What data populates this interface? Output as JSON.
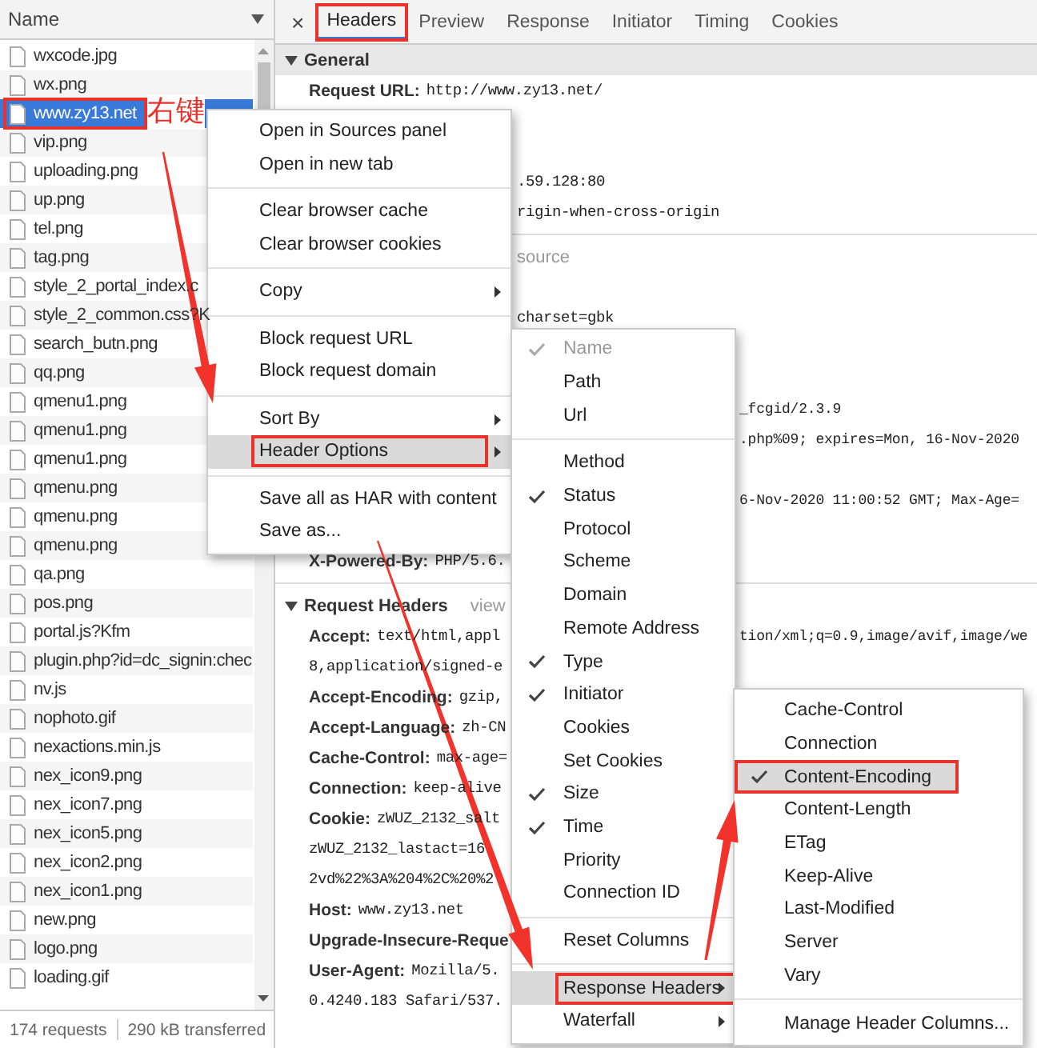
{
  "file_list": {
    "header": "Name",
    "files": [
      {
        "name": "wxcode.jpg",
        "selected": false,
        "boxed": false
      },
      {
        "name": "wx.png",
        "selected": false,
        "boxed": false
      },
      {
        "name": "www.zy13.net",
        "selected": true,
        "boxed": true
      },
      {
        "name": "vip.png",
        "selected": false,
        "boxed": false
      },
      {
        "name": "uploading.png",
        "selected": false,
        "boxed": false
      },
      {
        "name": "up.png",
        "selected": false,
        "boxed": false
      },
      {
        "name": "tel.png",
        "selected": false,
        "boxed": false
      },
      {
        "name": "tag.png",
        "selected": false,
        "boxed": false
      },
      {
        "name": "style_2_portal_index.c",
        "selected": false,
        "boxed": false
      },
      {
        "name": "style_2_common.css?K",
        "selected": false,
        "boxed": false
      },
      {
        "name": "search_butn.png",
        "selected": false,
        "boxed": false
      },
      {
        "name": "qq.png",
        "selected": false,
        "boxed": false
      },
      {
        "name": "qmenu1.png",
        "selected": false,
        "boxed": false
      },
      {
        "name": "qmenu1.png",
        "selected": false,
        "boxed": false
      },
      {
        "name": "qmenu1.png",
        "selected": false,
        "boxed": false
      },
      {
        "name": "qmenu.png",
        "selected": false,
        "boxed": false
      },
      {
        "name": "qmenu.png",
        "selected": false,
        "boxed": false
      },
      {
        "name": "qmenu.png",
        "selected": false,
        "boxed": false
      },
      {
        "name": "qa.png",
        "selected": false,
        "boxed": false
      },
      {
        "name": "pos.png",
        "selected": false,
        "boxed": false
      },
      {
        "name": "portal.js?Kfm",
        "selected": false,
        "boxed": false
      },
      {
        "name": "plugin.php?id=dc_signin:chec",
        "selected": false,
        "boxed": false
      },
      {
        "name": "nv.js",
        "selected": false,
        "boxed": false
      },
      {
        "name": "nophoto.gif",
        "selected": false,
        "boxed": false
      },
      {
        "name": "nexactions.min.js",
        "selected": false,
        "boxed": false
      },
      {
        "name": "nex_icon9.png",
        "selected": false,
        "boxed": false
      },
      {
        "name": "nex_icon7.png",
        "selected": false,
        "boxed": false
      },
      {
        "name": "nex_icon5.png",
        "selected": false,
        "boxed": false
      },
      {
        "name": "nex_icon2.png",
        "selected": false,
        "boxed": false
      },
      {
        "name": "nex_icon1.png",
        "selected": false,
        "boxed": false
      },
      {
        "name": "new.png",
        "selected": false,
        "boxed": false
      },
      {
        "name": "logo.png",
        "selected": false,
        "boxed": false
      },
      {
        "name": "loading.gif",
        "selected": false,
        "boxed": false
      }
    ],
    "status": {
      "requests": "174 requests",
      "transferred": "290 kB transferred"
    }
  },
  "annotation": "右键",
  "tabs": [
    {
      "label": "Headers",
      "selected": true,
      "boxed": true
    },
    {
      "label": "Preview",
      "selected": false,
      "boxed": false
    },
    {
      "label": "Response",
      "selected": false,
      "boxed": false
    },
    {
      "label": "Initiator",
      "selected": false,
      "boxed": false
    },
    {
      "label": "Timing",
      "selected": false,
      "boxed": false
    },
    {
      "label": "Cookies",
      "selected": false,
      "boxed": false
    }
  ],
  "close_glyph": "×",
  "lines": [
    {
      "kind": "section",
      "title": "General",
      "shaded": true
    },
    {
      "kind": "row",
      "key": "Request URL:",
      "value": "http://www.zy13.net/"
    },
    {
      "kind": "blank"
    },
    {
      "kind": "blank"
    },
    {
      "kind": "mid",
      "text": ".59.128:80"
    },
    {
      "kind": "mid",
      "text": "rigin-when-cross-origin"
    },
    {
      "kind": "rule"
    },
    {
      "kind": "mid-link",
      "text": "source"
    },
    {
      "kind": "blank"
    },
    {
      "kind": "mid",
      "text": "charset=gbk"
    },
    {
      "kind": "blank"
    },
    {
      "kind": "blank"
    },
    {
      "kind": "far",
      "text": "_fcgid/2.3.9"
    },
    {
      "kind": "far",
      "text": ".php%09; expires=Mon, 16-Nov-2020"
    },
    {
      "kind": "blank"
    },
    {
      "kind": "far",
      "text": "6-Nov-2020 11:00:52 GMT; Max-Age="
    },
    {
      "kind": "blank"
    },
    {
      "kind": "row",
      "key": "X-Powered-By:",
      "value": "PHP/5.6."
    },
    {
      "kind": "rule"
    },
    {
      "kind": "section",
      "title": "Request Headers",
      "shaded": false,
      "link": "view"
    },
    {
      "kind": "row",
      "key": "Accept:",
      "value": "text/html,appl",
      "far": "tion/xml;q=0.9,image/avif,image/we"
    },
    {
      "kind": "cont",
      "value": "8,application/signed-e"
    },
    {
      "kind": "row",
      "key": "Accept-Encoding:",
      "value": "gzip,"
    },
    {
      "kind": "row",
      "key": "Accept-Language:",
      "value": "zh-CN"
    },
    {
      "kind": "row",
      "key": "Cache-Control:",
      "value": "max-age="
    },
    {
      "kind": "row",
      "key": "Connection:",
      "value": "keep-alive"
    },
    {
      "kind": "row",
      "key": "Cookie:",
      "value": "zWUZ_2132_salt"
    },
    {
      "kind": "cont",
      "value": "zWUZ_2132_lastact=16"
    },
    {
      "kind": "cont",
      "value": "2vd%22%3A%204%2C%20%2"
    },
    {
      "kind": "row",
      "key": "Host:",
      "value": "www.zy13.net"
    },
    {
      "kind": "row",
      "key": "Upgrade-Insecure-Reque"
    },
    {
      "kind": "row",
      "key": "User-Agent:",
      "value": "Mozilla/5."
    },
    {
      "kind": "cont",
      "value": "0.4240.183 Safari/537."
    }
  ],
  "context_menu": {
    "items": [
      {
        "kind": "item",
        "label": "Open in Sources panel",
        "submenu": false,
        "hovered": false,
        "boxed": false
      },
      {
        "kind": "item",
        "label": "Open in new tab",
        "submenu": false,
        "hovered": false,
        "boxed": false
      },
      {
        "kind": "separator"
      },
      {
        "kind": "item",
        "label": "Clear browser cache",
        "submenu": false,
        "hovered": false,
        "boxed": false
      },
      {
        "kind": "item",
        "label": "Clear browser cookies",
        "submenu": false,
        "hovered": false,
        "boxed": false
      },
      {
        "kind": "separator"
      },
      {
        "kind": "item",
        "label": "Copy",
        "submenu": true,
        "hovered": false,
        "boxed": false
      },
      {
        "kind": "separator"
      },
      {
        "kind": "item",
        "label": "Block request URL",
        "submenu": false,
        "hovered": false,
        "boxed": false
      },
      {
        "kind": "item",
        "label": "Block request domain",
        "submenu": false,
        "hovered": false,
        "boxed": false
      },
      {
        "kind": "separator"
      },
      {
        "kind": "item",
        "label": "Sort By",
        "submenu": true,
        "hovered": false,
        "boxed": false
      },
      {
        "kind": "item",
        "label": "Header Options",
        "submenu": true,
        "hovered": true,
        "boxed": true
      },
      {
        "kind": "separator"
      },
      {
        "kind": "item",
        "label": "Save all as HAR with content",
        "submenu": false,
        "hovered": false,
        "boxed": false
      },
      {
        "kind": "item",
        "label": "Save as...",
        "submenu": false,
        "hovered": false,
        "boxed": false
      }
    ]
  },
  "column_menu": {
    "items": [
      {
        "kind": "item",
        "label": "Name",
        "checked": true,
        "disabled": true,
        "submenu": false,
        "hovered": false,
        "boxed": false
      },
      {
        "kind": "item",
        "label": "Path",
        "checked": false,
        "disabled": false,
        "submenu": false,
        "hovered": false,
        "boxed": false
      },
      {
        "kind": "item",
        "label": "Url",
        "checked": false,
        "disabled": false,
        "submenu": false,
        "hovered": false,
        "boxed": false
      },
      {
        "kind": "separator"
      },
      {
        "kind": "item",
        "label": "Method",
        "checked": false,
        "disabled": false,
        "submenu": false,
        "hovered": false,
        "boxed": false
      },
      {
        "kind": "item",
        "label": "Status",
        "checked": true,
        "disabled": false,
        "submenu": false,
        "hovered": false,
        "boxed": false
      },
      {
        "kind": "item",
        "label": "Protocol",
        "checked": false,
        "disabled": false,
        "submenu": false,
        "hovered": false,
        "boxed": false
      },
      {
        "kind": "item",
        "label": "Scheme",
        "checked": false,
        "disabled": false,
        "submenu": false,
        "hovered": false,
        "boxed": false
      },
      {
        "kind": "item",
        "label": "Domain",
        "checked": false,
        "disabled": false,
        "submenu": false,
        "hovered": false,
        "boxed": false
      },
      {
        "kind": "item",
        "label": "Remote Address",
        "checked": false,
        "disabled": false,
        "submenu": false,
        "hovered": false,
        "boxed": false
      },
      {
        "kind": "item",
        "label": "Type",
        "checked": true,
        "disabled": false,
        "submenu": false,
        "hovered": false,
        "boxed": false
      },
      {
        "kind": "item",
        "label": "Initiator",
        "checked": true,
        "disabled": false,
        "submenu": false,
        "hovered": false,
        "boxed": false
      },
      {
        "kind": "item",
        "label": "Cookies",
        "checked": false,
        "disabled": false,
        "submenu": false,
        "hovered": false,
        "boxed": false
      },
      {
        "kind": "item",
        "label": "Set Cookies",
        "checked": false,
        "disabled": false,
        "submenu": false,
        "hovered": false,
        "boxed": false
      },
      {
        "kind": "item",
        "label": "Size",
        "checked": true,
        "disabled": false,
        "submenu": false,
        "hovered": false,
        "boxed": false
      },
      {
        "kind": "item",
        "label": "Time",
        "checked": true,
        "disabled": false,
        "submenu": false,
        "hovered": false,
        "boxed": false
      },
      {
        "kind": "item",
        "label": "Priority",
        "checked": false,
        "disabled": false,
        "submenu": false,
        "hovered": false,
        "boxed": false
      },
      {
        "kind": "item",
        "label": "Connection ID",
        "checked": false,
        "disabled": false,
        "submenu": false,
        "hovered": false,
        "boxed": false
      },
      {
        "kind": "separator"
      },
      {
        "kind": "item",
        "label": "Reset Columns",
        "checked": false,
        "disabled": false,
        "submenu": false,
        "hovered": false,
        "boxed": false
      },
      {
        "kind": "separator"
      },
      {
        "kind": "item",
        "label": "Response Headers",
        "checked": false,
        "disabled": false,
        "submenu": true,
        "hovered": true,
        "boxed": true
      },
      {
        "kind": "item",
        "label": "Waterfall",
        "checked": false,
        "disabled": false,
        "submenu": true,
        "hovered": false,
        "boxed": false
      }
    ]
  },
  "header_menu": {
    "items": [
      {
        "kind": "item",
        "label": "Cache-Control",
        "checked": false,
        "hovered": false,
        "boxed": false
      },
      {
        "kind": "item",
        "label": "Connection",
        "checked": false,
        "hovered": false,
        "boxed": false
      },
      {
        "kind": "item",
        "label": "Content-Encoding",
        "checked": true,
        "hovered": true,
        "boxed": true
      },
      {
        "kind": "item",
        "label": "Content-Length",
        "checked": false,
        "hovered": false,
        "boxed": false
      },
      {
        "kind": "item",
        "label": "ETag",
        "checked": false,
        "hovered": false,
        "boxed": false
      },
      {
        "kind": "item",
        "label": "Keep-Alive",
        "checked": false,
        "hovered": false,
        "boxed": false
      },
      {
        "kind": "item",
        "label": "Last-Modified",
        "checked": false,
        "hovered": false,
        "boxed": false
      },
      {
        "kind": "item",
        "label": "Server",
        "checked": false,
        "hovered": false,
        "boxed": false
      },
      {
        "kind": "item",
        "label": "Vary",
        "checked": false,
        "hovered": false,
        "boxed": false
      },
      {
        "kind": "separator"
      },
      {
        "kind": "item",
        "label": "Manage Header Columns...",
        "checked": false,
        "hovered": false,
        "boxed": false
      }
    ]
  }
}
